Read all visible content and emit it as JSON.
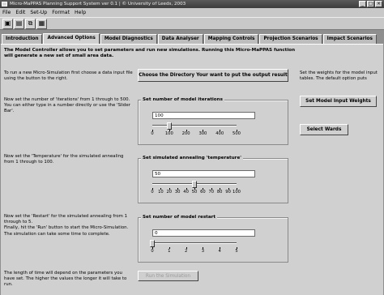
{
  "window": {
    "title": "Micro-MaPPAS Planning Support System ver 0.1  |  © University of Leeds, 2003"
  },
  "menu": [
    "File",
    "Edit",
    "Set-Up",
    "Format",
    "Help"
  ],
  "toolbar": [
    {
      "icon": "window-icon",
      "glyph": "▣"
    },
    {
      "icon": "save-icon",
      "glyph": "▤"
    },
    {
      "icon": "layers-icon",
      "glyph": "⧉"
    },
    {
      "icon": "properties-icon",
      "glyph": "▦"
    }
  ],
  "tabs": [
    {
      "label": "Introduction",
      "active": false
    },
    {
      "label": "Advanced Options",
      "active": true
    },
    {
      "label": "Model Diagnostics",
      "active": false
    },
    {
      "label": "Data Analyser",
      "active": false
    },
    {
      "label": "Mapping Controls",
      "active": false
    },
    {
      "label": "Projection Scenarios",
      "active": false
    },
    {
      "label": "Impact Scenarios",
      "active": false
    }
  ],
  "intro": "The Model Controller allows you to set parameters and run new simulations. Running this Micro-MaPPAS function will generate a new set of small area data.",
  "notes": {
    "directory": "To run a new Micro-Simulation first choose a data input file using the button to the right.",
    "iterations": "Now set the number of 'iterations' from 1 through to 500. You can either type in a number directly or use the 'Slider Bar'.",
    "temperature": "Now set the 'Temperature' for the simulated annealing from 1 through to 100.",
    "restart": "Now set the 'Restart' for the simulated annealing from 1 through to 5.\nFinally, hit the 'Run' button to start the Micro-Simulation. The simulation can take some time to complete.",
    "length": "The length of time will depend on the parameters you have set. The higher the values the longer it will take to run.",
    "weights": "Set the weights for the model input tables. The default option puts"
  },
  "buttons": {
    "directory": "Choose the Directory Your want to put the output result",
    "weights": "Set Model Input Weights",
    "wards": "Select Wards",
    "run": "Run the Simulation"
  },
  "iterations": {
    "title": "Set number of model iterations",
    "value": "100",
    "slider": 100,
    "min": 0,
    "max": 500,
    "ticks": [
      "0",
      "100",
      "200",
      "300",
      "400",
      "500"
    ]
  },
  "temperature": {
    "title": "Set simulated annealing 'temperature'",
    "value": "50",
    "slider": 50,
    "min": 0,
    "max": 100,
    "ticks": [
      "0",
      "10",
      "20",
      "30",
      "40",
      "50",
      "60",
      "70",
      "80",
      "90",
      "100"
    ]
  },
  "restart": {
    "title": "Set number of model restart",
    "value": "0",
    "slider": 0,
    "min": 0,
    "max": 5,
    "ticks": [
      "0",
      "1",
      "2",
      "3",
      "4",
      "5"
    ]
  }
}
